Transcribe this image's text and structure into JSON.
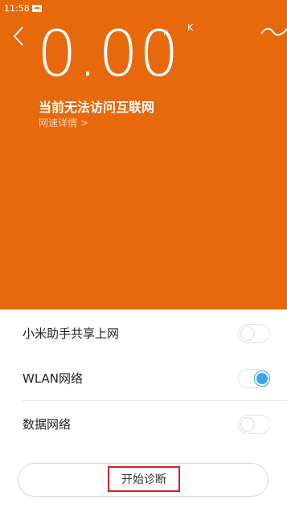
{
  "status_bar": {
    "time": "11:58"
  },
  "speed": {
    "value": "0.00",
    "unit_small": "K",
    "unit_right": "K"
  },
  "connection": {
    "status": "当前无法访问互联网",
    "details_link": "网速详情 >"
  },
  "network_settings": [
    {
      "label": "小米助手共享上网",
      "enabled": false
    },
    {
      "label": "WLAN网络",
      "enabled": true
    },
    {
      "label": "数据网络",
      "enabled": false
    }
  ],
  "diagnose_button": {
    "label": "开始诊断"
  },
  "colors": {
    "accent": "#e8680c",
    "toggle_on": "#37a7ee",
    "highlight": "#d9202a"
  }
}
